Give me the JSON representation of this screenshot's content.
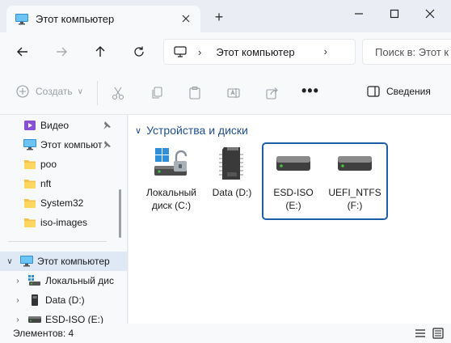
{
  "window": {
    "tab_title": "Этот компьютер",
    "new_tab_symbol": "+"
  },
  "address": {
    "location": "Этот компьютер",
    "search_placeholder": "Поиск в: Этот к"
  },
  "toolbar": {
    "create_label": "Создать",
    "more_label": "•••",
    "details_label": "Сведения"
  },
  "sidebar": {
    "quick_access": [
      {
        "label": "Видео",
        "icon": "video-folder-icon",
        "pinned": true
      },
      {
        "label": "Этот компьют",
        "icon": "computer-icon",
        "pinned": true
      },
      {
        "label": "poo",
        "icon": "folder-icon",
        "pinned": false
      },
      {
        "label": "nft",
        "icon": "folder-icon",
        "pinned": false
      },
      {
        "label": "System32",
        "icon": "folder-icon",
        "pinned": false
      },
      {
        "label": "iso-images",
        "icon": "folder-icon",
        "pinned": false
      }
    ],
    "tree": [
      {
        "label": "Этот компьютер",
        "icon": "computer-icon",
        "expanded": true,
        "selected": true
      },
      {
        "label": "Локальный дис",
        "icon": "windows-drive-icon",
        "expanded": false
      },
      {
        "label": "Data (D:)",
        "icon": "usb-drive-icon",
        "expanded": false
      },
      {
        "label": "ESD-ISO (E:)",
        "icon": "hdd-icon",
        "expanded": false
      }
    ]
  },
  "content": {
    "group_title": "Устройства и диски",
    "drives": [
      {
        "line1": "Локальный",
        "line2": "диск (C:)",
        "icon": "windows-drive-icon"
      },
      {
        "line1": "Data (D:)",
        "line2": "",
        "icon": "sd-card-icon"
      },
      {
        "line1": "ESD-ISO",
        "line2": "(E:)",
        "icon": "hdd-icon"
      },
      {
        "line1": "UEFI_NTFS",
        "line2": "(F:)",
        "icon": "hdd-icon"
      }
    ]
  },
  "status": {
    "items_count": "Элементов: 4"
  },
  "colors": {
    "accent": "#1c5fa8",
    "group_title": "#1f4e8c",
    "selection_bg": "#dfe8f5",
    "drive_led": "#3ec43e"
  }
}
